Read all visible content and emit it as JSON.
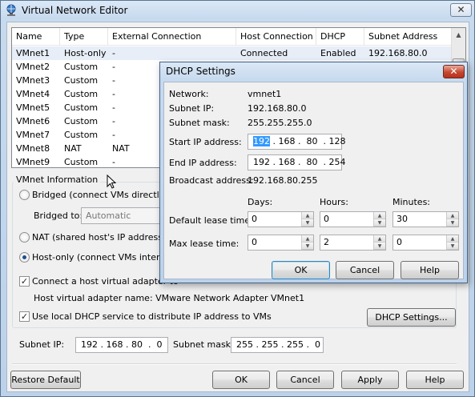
{
  "window": {
    "title": "Virtual Network Editor",
    "close_glyph": "✕"
  },
  "list": {
    "columns": [
      "Name",
      "Type",
      "External Connection",
      "Host Connection",
      "DHCP",
      "Subnet Address"
    ],
    "rows": [
      [
        "VMnet1",
        "Host-only",
        "-",
        "Connected",
        "Enabled",
        "192.168.80.0"
      ],
      [
        "VMnet2",
        "Custom",
        "-",
        "",
        "",
        ""
      ],
      [
        "VMnet3",
        "Custom",
        "-",
        "",
        "",
        ""
      ],
      [
        "VMnet4",
        "Custom",
        "-",
        "",
        "",
        ""
      ],
      [
        "VMnet5",
        "Custom",
        "-",
        "",
        "",
        ""
      ],
      [
        "VMnet6",
        "Custom",
        "-",
        "",
        "",
        ""
      ],
      [
        "VMnet7",
        "Custom",
        "-",
        "",
        "",
        ""
      ],
      [
        "VMnet8",
        "NAT",
        "NAT",
        "",
        "",
        ""
      ],
      [
        "VMnet9",
        "Custom",
        "-",
        "",
        "",
        ""
      ]
    ]
  },
  "vmnet_info": {
    "title": "VMnet Information",
    "bridged_label": "Bridged (connect VMs directly to t",
    "bridged_to_label": "Bridged to:",
    "bridged_to_value": "Automatic",
    "nat_label": "NAT (shared host's IP address wit",
    "hostonly_label": "Host-only (connect VMs internally",
    "selected_mode": "host-only",
    "connect_adapter_label": "Connect a host virtual adapter to",
    "adapter_name_text": "Host virtual adapter name: VMware Network Adapter VMnet1",
    "use_dhcp_label": "Use local DHCP service to distribute IP address to VMs",
    "dhcp_settings_button": "DHCP Settings...",
    "subnet_ip_label": "Subnet IP:",
    "subnet_ip_value": "192 . 168 . 80  .  0",
    "subnet_mask_label": "Subnet mask:",
    "subnet_mask_value": "255 . 255 . 255 .  0"
  },
  "footer": {
    "restore_default": "Restore Default",
    "ok": "OK",
    "cancel": "Cancel",
    "apply": "Apply",
    "help": "Help"
  },
  "dhcp_dialog": {
    "title": "DHCP Settings",
    "close_glyph": "✕",
    "network_label": "Network:",
    "network_value": "vmnet1",
    "subnet_ip_label": "Subnet IP:",
    "subnet_ip_value": "192.168.80.0",
    "subnet_mask_label": "Subnet mask:",
    "subnet_mask_value": "255.255.255.0",
    "start_ip_label": "Start IP address:",
    "start_ip_first": "192",
    "start_ip_rest": " . 168 .  80  . 128",
    "end_ip_label": "End IP address:",
    "end_ip_value": "192 . 168 .  80  . 254",
    "broadcast_label": "Broadcast address:",
    "broadcast_value": "192.168.80.255",
    "days_label": "Days:",
    "hours_label": "Hours:",
    "minutes_label": "Minutes:",
    "default_lease_label": "Default lease time:",
    "default_lease": {
      "days": "0",
      "hours": "0",
      "minutes": "30"
    },
    "max_lease_label": "Max lease time:",
    "max_lease": {
      "days": "0",
      "hours": "2",
      "minutes": "0"
    },
    "ok": "OK",
    "cancel": "Cancel",
    "help": "Help"
  }
}
